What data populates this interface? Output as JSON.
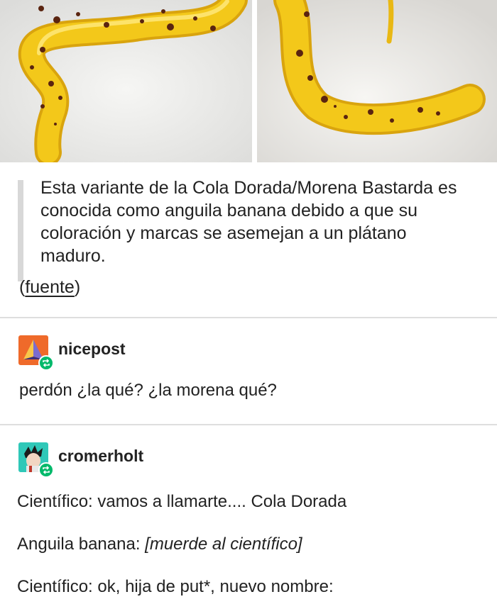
{
  "images": {
    "left_photo": "banana-eel-photo-left",
    "right_photo": "banana-eel-photo-right"
  },
  "post": {
    "quote": "Esta variante de la Cola Dorada/Morena Bastarda es conocida como anguila banana debido a que su coloración y marcas se asemejan a un plátano maduro.",
    "source_open": "(",
    "source_link": "fuente",
    "source_close": ")"
  },
  "reblogs": [
    {
      "username": "nicepost",
      "text": "perdón ¿la qué? ¿la morena qué?"
    },
    {
      "username": "cromerholt",
      "lines": [
        {
          "speaker": "Científico: ",
          "text": "vamos a llamarte.... Cola Dorada",
          "italic": false
        },
        {
          "speaker": "Anguila banana: ",
          "text": "[muerde al científico]",
          "italic": true
        },
        {
          "speaker": "Científico: ",
          "text": "ok, hija de put*, nuevo nombre:",
          "italic": false
        }
      ]
    }
  ],
  "colors": {
    "eel_yellow": "#f3c81a",
    "spot_brown": "#5a2410",
    "reblog_green": "#00b96b"
  }
}
